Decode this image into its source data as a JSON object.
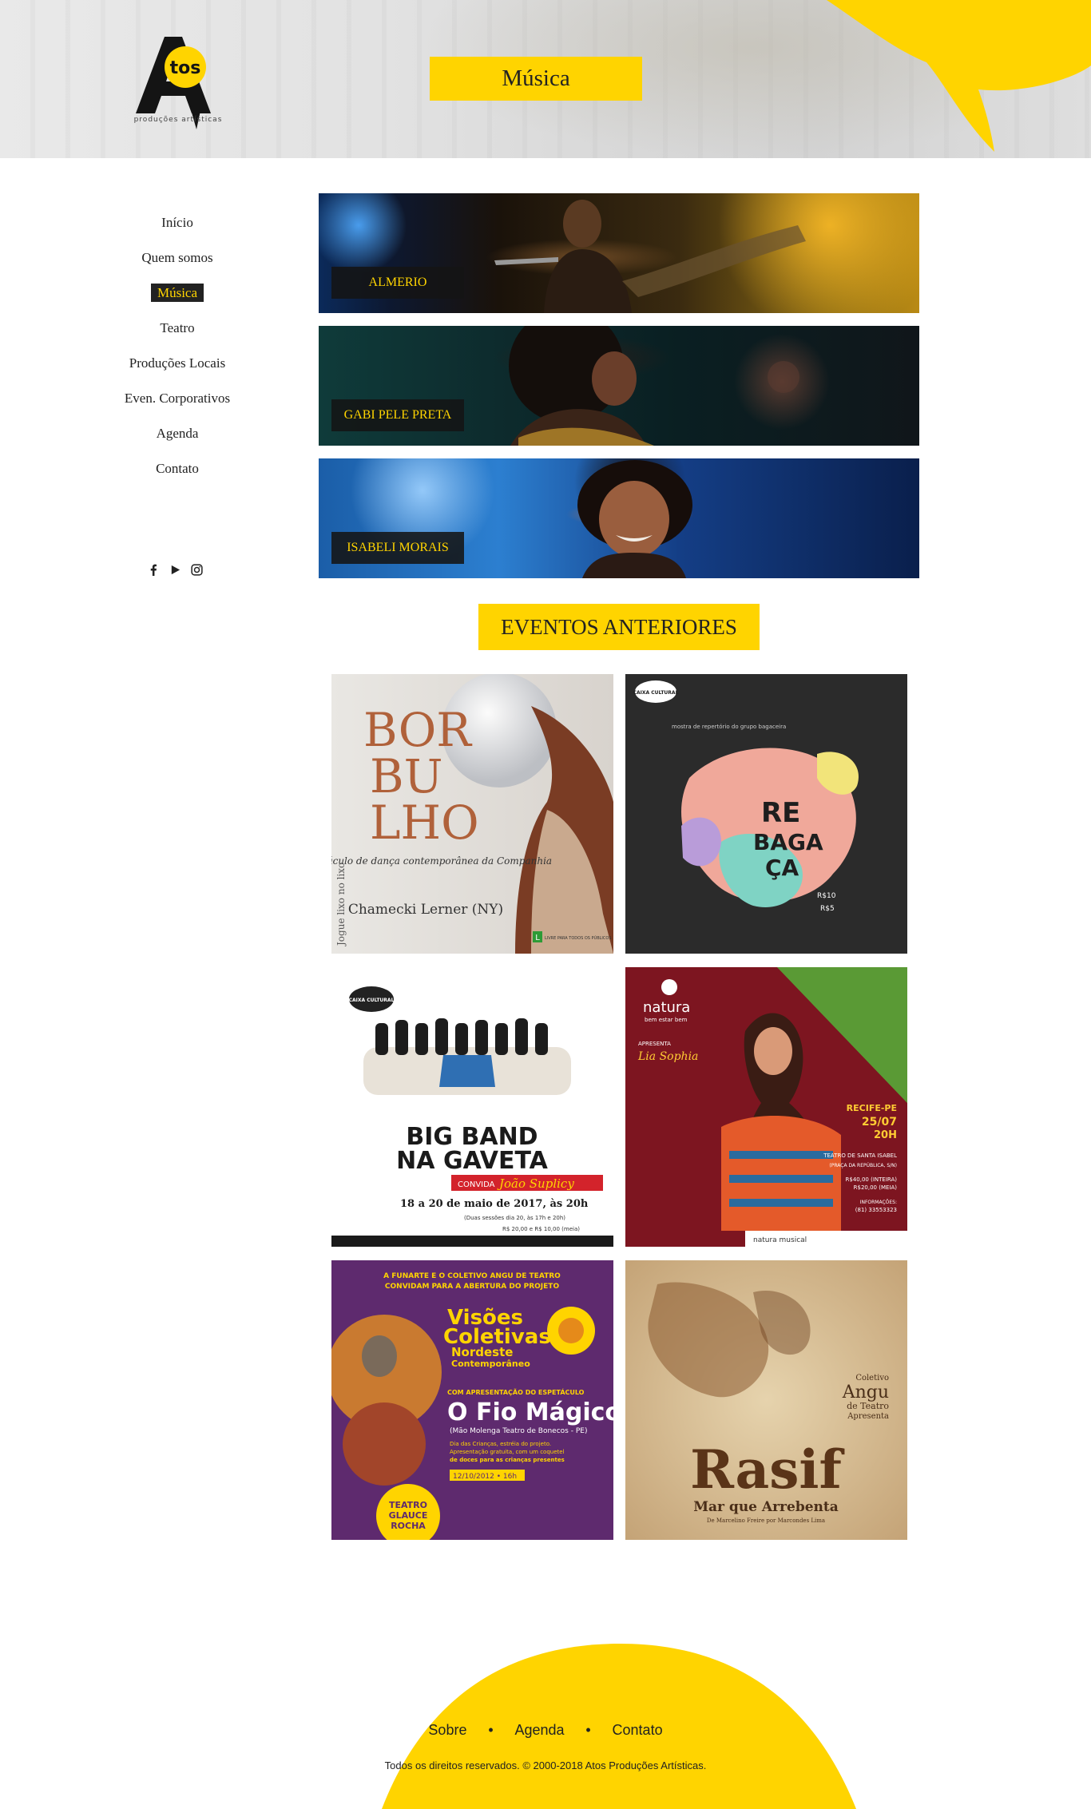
{
  "brand": {
    "logo_letters": "A",
    "logo_bubble": "tos",
    "logo_tagline": "produções artísticas",
    "accent": "#ffd400",
    "dark": "#222222"
  },
  "header": {
    "title": "Música"
  },
  "nav": {
    "items": [
      {
        "label": "Início",
        "active": false
      },
      {
        "label": "Quem somos",
        "active": false
      },
      {
        "label": "Música",
        "active": true
      },
      {
        "label": "Teatro",
        "active": false
      },
      {
        "label": "Produções Locais",
        "active": false
      },
      {
        "label": "Even. Corporativos",
        "active": false
      },
      {
        "label": "Agenda",
        "active": false
      },
      {
        "label": "Contato",
        "active": false
      }
    ],
    "social": [
      "facebook-icon",
      "youtube-icon",
      "instagram-icon"
    ]
  },
  "artists": [
    {
      "name": "ALMERIO"
    },
    {
      "name": "GABI PELE PRETA"
    },
    {
      "name": "ISABELI MORAIS"
    }
  ],
  "events": {
    "title": "EVENTOS ANTERIORES",
    "posters": [
      {
        "name": "Borbulho",
        "title_lines": [
          "BOR",
          "BU",
          "LHO"
        ],
        "subtitle": "Espetáculo de dança contemporânea da Companhia",
        "company": "Chamecki Lerner (NY)",
        "side_text": "Jogue lixo no lixo",
        "rating": "L",
        "rating_text": "LIVRE PARA TODOS OS PÚBLICOS"
      },
      {
        "name": "Rebagaça",
        "header": "CAIXA CULTURAL",
        "intro": "mostra de repertório do grupo bagaceira",
        "title_lines": [
          "RE",
          "BAGA",
          "ÇA"
        ],
        "price_1": "R$10",
        "price_2": "R$5"
      },
      {
        "name": "Big Band na Gaveta",
        "header": "CAIXA CULTURAL",
        "title_lines": [
          "BIG BAND",
          "NA GAVETA"
        ],
        "guest_prefix": "CONVIDA",
        "guest": "João Suplicy",
        "dates": "18 a 20 de maio de 2017, às 20h",
        "note": "(Duas sessões dia 20, às 17h e 20h)",
        "price": "R$ 20,00 e R$ 10,00 (meia)"
      },
      {
        "name": "Lia Sophia",
        "brand": "natura",
        "brand_tagline": "bem estar bem",
        "presents": "APRESENTA",
        "artist": "Lia Sophia",
        "city": "RECIFE-PE",
        "date": "25/07",
        "time": "20H",
        "venue": "TEATRO DE SANTA ISABEL",
        "address": "(PRAÇA DA REPÚBLICA, S/N)",
        "price_full": "R$40,00 (INTEIRA)",
        "price_half": "R$20,00 (MEIA)",
        "info_label": "INFORMAÇÕES:",
        "info_phone": "(81) 33553323",
        "footer_brand": "natura musical"
      },
      {
        "name": "Visões Coletivas",
        "intro_1": "A FUNARTE E O COLETIVO ANGU DE TEATRO",
        "intro_2": "CONVIDAM PARA A ABERTURA DO PROJETO",
        "title_1": "Visões",
        "title_2": "Coletivas",
        "title_3": "Nordeste",
        "title_4": "Contemporâneo",
        "with": "COM APRESENTAÇÃO DO ESPETÁCULO",
        "show": "O Fio Mágico",
        "show_sub": "(Mão Molenga Teatro de Bonecos - PE)",
        "desc_1": "Dia das Crianças, estréia do projeto.",
        "desc_2": "Apresentação gratuita, com um coquetel",
        "desc_3": "de doces para as crianças presentes",
        "date": "12/10/2012 • 16h",
        "venue_1": "TEATRO",
        "venue_2": "GLAUCE",
        "venue_3": "ROCHA"
      },
      {
        "name": "Rasif",
        "group_1": "Coletivo",
        "group_2": "Angu",
        "group_3": "de Teatro",
        "group_4": "Apresenta",
        "title": "Rasif",
        "subtitle": "Mar que Arrebenta",
        "credit": "De Marcelino Freire por Marcondes Lima"
      }
    ]
  },
  "footer": {
    "links": [
      "Sobre",
      "Agenda",
      "Contato"
    ],
    "copyright": "Todos os direitos reservados. © 2000-2018 Atos Produções Artísticas."
  }
}
